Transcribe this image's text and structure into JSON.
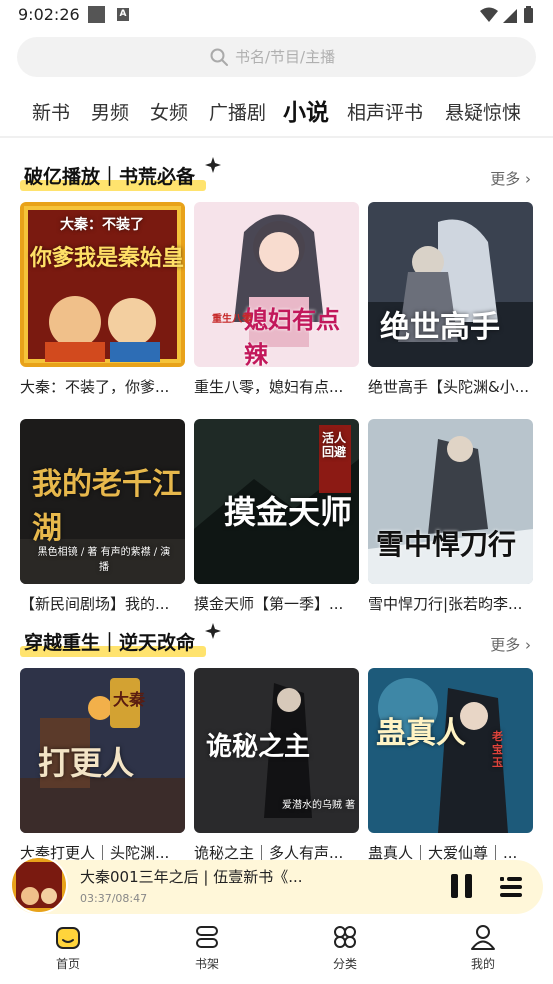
{
  "status_bar": {
    "time": "9:02:26"
  },
  "search": {
    "placeholder": "书名/节目/主播"
  },
  "tabs": [
    {
      "label": "新书"
    },
    {
      "label": "男频"
    },
    {
      "label": "女频"
    },
    {
      "label": "广播剧"
    },
    {
      "label": "小说",
      "active": true
    },
    {
      "label": "相声评书"
    },
    {
      "label": "悬疑惊悚"
    }
  ],
  "sections": [
    {
      "title": "破亿播放｜书荒必备",
      "more": "更多",
      "books": [
        {
          "name": "大秦：不装了，你爹...",
          "cover_title": "你爹我是秦始皇",
          "cover_tag": "大秦：不装了"
        },
        {
          "name": "重生八零，媳妇有点...",
          "cover_title": "媳妇有点辣",
          "cover_tag": "重生八零"
        },
        {
          "name": "绝世高手【头陀渊&小...",
          "cover_title": "绝世高手",
          "cover_tag": ""
        },
        {
          "name": "【新民间剧场】我的...",
          "cover_title": "我的老千江湖",
          "cover_tag": "黑色相镜 / 著  有声的紫襟 / 演播"
        },
        {
          "name": "摸金天师【第一季】...",
          "cover_title": "摸金天师",
          "cover_tag": "活人回避"
        },
        {
          "name": "雪中悍刀行|张若昀李...",
          "cover_title": "雪中悍刀行",
          "cover_tag": ""
        }
      ]
    },
    {
      "title": "穿越重生｜逆天改命",
      "more": "更多",
      "books": [
        {
          "name": "大秦打更人｜头陀渊...",
          "cover_title": "打更人",
          "cover_tag": "大秦"
        },
        {
          "name": "诡秘之主｜多人有声...",
          "cover_title": "诡秘之主",
          "cover_tag": "爱潜水的乌贼 著"
        },
        {
          "name": "蛊真人｜大爱仙尊｜...",
          "cover_title": "蛊真人",
          "cover_tag": "老宝玉"
        }
      ]
    }
  ],
  "player": {
    "title": "大秦001三年之后 | 伍壹新书《...",
    "time": "03:37/08:47",
    "progress": 0.414
  },
  "nav": [
    {
      "label": "首页",
      "icon": "home-icon",
      "active": true
    },
    {
      "label": "书架",
      "icon": "bookshelf-icon"
    },
    {
      "label": "分类",
      "icon": "category-icon"
    },
    {
      "label": "我的",
      "icon": "profile-icon"
    }
  ],
  "colors": {
    "accent": "#ffd43b",
    "highlight": "#ffe36e",
    "player_bg": "#fff7d9"
  }
}
